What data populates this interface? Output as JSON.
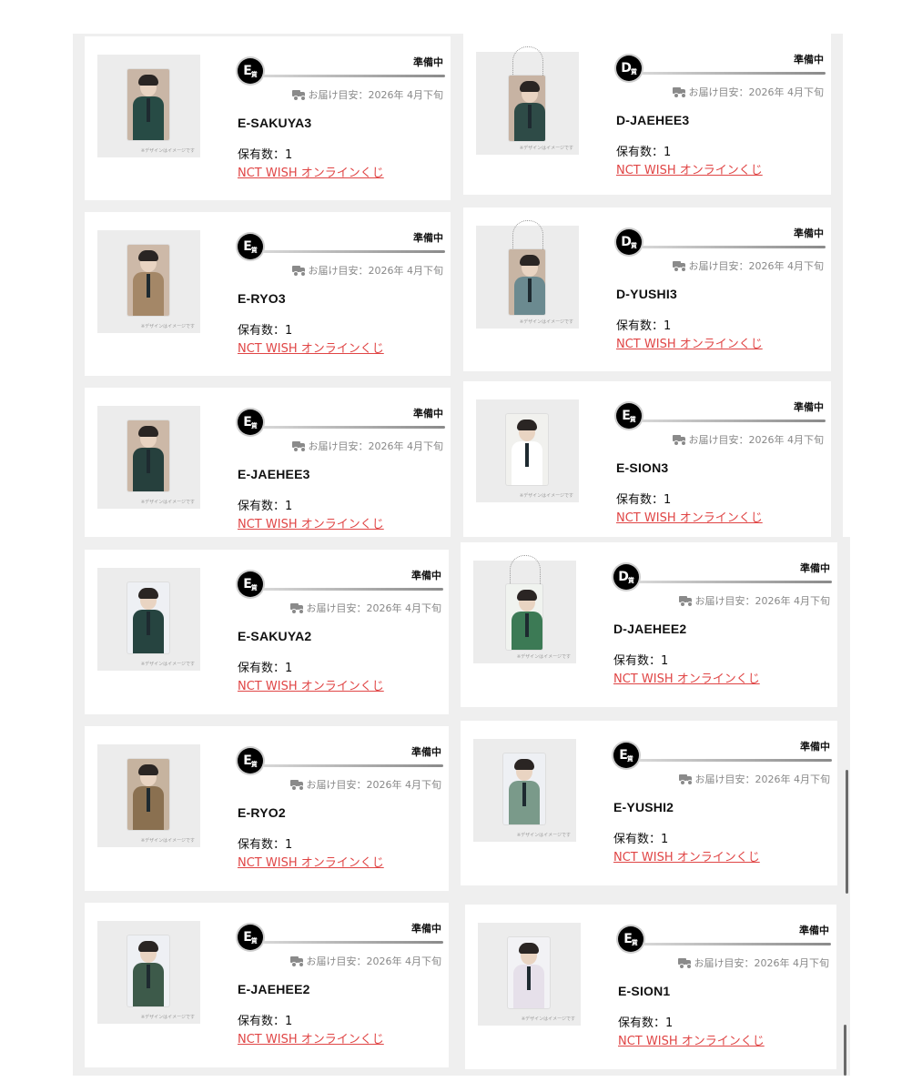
{
  "common": {
    "status": "準備中",
    "delivery": "お届け目安：2026年 4月下旬",
    "owned": "保有数：1",
    "link": "NCT WISH オンラインくじ",
    "image_caption": "※デザインはイメージです",
    "prize_suffix": "賞"
  },
  "items": [
    {
      "name": "E-SAKUYA3",
      "prize": "E",
      "type": "card",
      "palette": [
        "#c9b6a6",
        "#274b45"
      ]
    },
    {
      "name": "D-JAEHEE3",
      "prize": "D",
      "type": "keychain",
      "palette": [
        "#c7b3a3",
        "#2e4b47"
      ]
    },
    {
      "name": "E-RYO3",
      "prize": "E",
      "type": "card",
      "palette": [
        "#cdb9a8",
        "#a48767"
      ]
    },
    {
      "name": "D-YUSHI3",
      "prize": "D",
      "type": "keychain",
      "palette": [
        "#c8b5a4",
        "#6b8a90"
      ]
    },
    {
      "name": "E-JAEHEE3",
      "prize": "E",
      "type": "card",
      "palette": [
        "#ccb8a7",
        "#26403d"
      ]
    },
    {
      "name": "E-SION3",
      "prize": "E",
      "type": "card",
      "palette": [
        "#f1f1ee",
        "#ffffff"
      ]
    },
    {
      "name": "E-SAKUYA2",
      "prize": "E",
      "type": "card",
      "palette": [
        "#eef0f4",
        "#264440"
      ]
    },
    {
      "name": "D-JAEHEE2",
      "prize": "D",
      "type": "keychain",
      "palette": [
        "#f0f3ef",
        "#3c7a55"
      ]
    },
    {
      "name": "E-RYO2",
      "prize": "E",
      "type": "card",
      "palette": [
        "#c6b39f",
        "#8a7050"
      ]
    },
    {
      "name": "E-YUSHI2",
      "prize": "E",
      "type": "card",
      "palette": [
        "#eef0f4",
        "#7a9a8a"
      ]
    },
    {
      "name": "E-JAEHEE2",
      "prize": "E",
      "type": "card",
      "palette": [
        "#eef0f4",
        "#3d5a4a"
      ]
    },
    {
      "name": "E-SION1",
      "prize": "E",
      "type": "card",
      "palette": [
        "#f2f2f5",
        "#e6e0ea"
      ]
    }
  ]
}
